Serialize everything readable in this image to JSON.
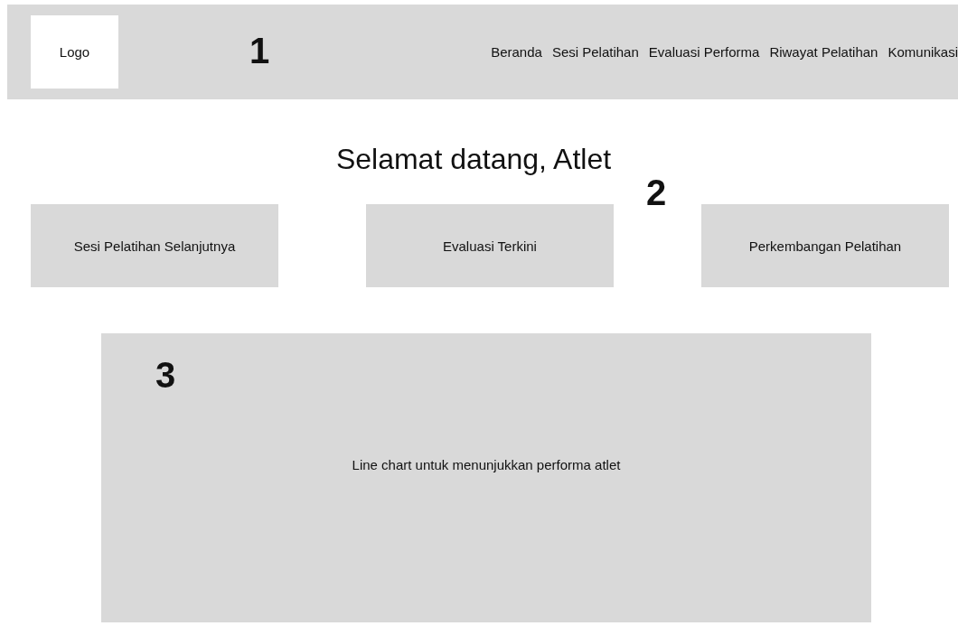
{
  "header": {
    "logo": "Logo",
    "marker": "1",
    "nav": [
      "Beranda",
      "Sesi Pelatihan",
      "Evaluasi Performa",
      "Riwayat Pelatihan",
      "Komunikasi"
    ]
  },
  "title": "Selamat datang, Atlet",
  "cards_marker": "2",
  "cards": [
    "Sesi Pelatihan Selanjutnya",
    "Evaluasi Terkini",
    "Perkembangan Pelatihan"
  ],
  "chart_panel": {
    "marker": "3",
    "text": "Line chart untuk menunjukkan performa atlet"
  }
}
